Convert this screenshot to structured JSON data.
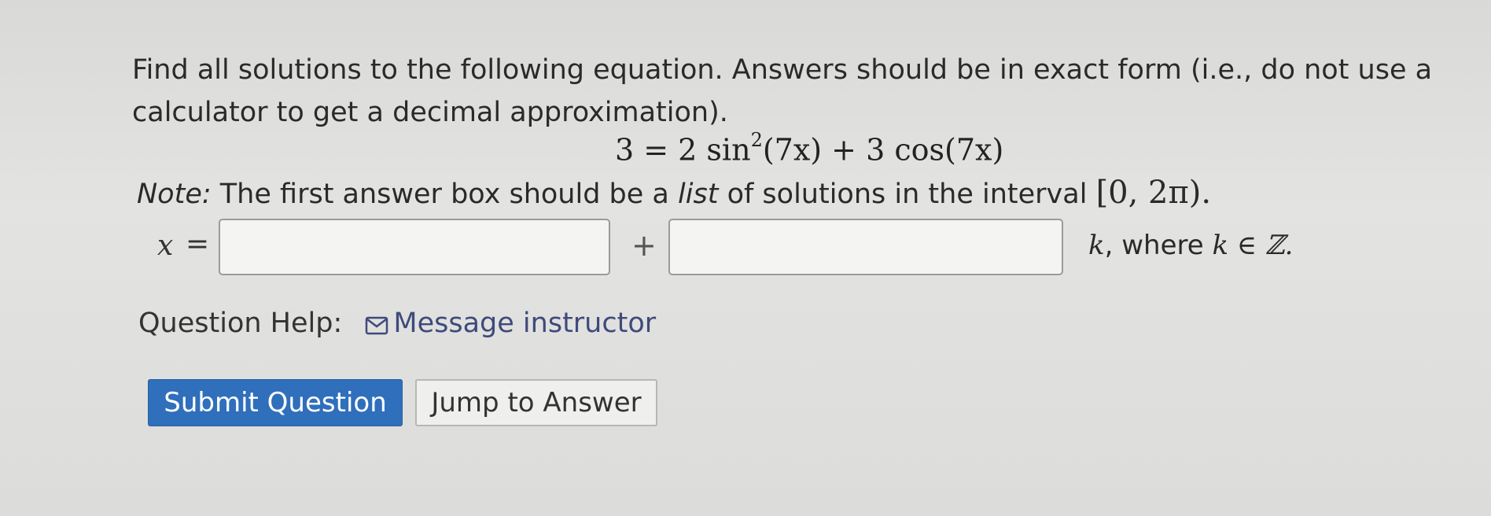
{
  "question": {
    "prompt": "Find all solutions to the following equation. Answers should be in exact form (i.e., do not use a calculator to get a decimal approximation).",
    "equation": {
      "lhs": "3 = 2 sin",
      "exponent": "2",
      "rhs": "(7x) + 3 cos(7x)"
    },
    "note_label": "Note:",
    "note_text_1": "The first answer box should be a",
    "note_emph": "list",
    "note_text_2": "of solutions in the interval",
    "note_interval": "[0, 2π)."
  },
  "answer": {
    "variable": "x",
    "equals": "=",
    "plus": "+",
    "box1_value": "",
    "box2_value": "",
    "suffix_k": "k",
    "suffix_text": ", where",
    "suffix_set": "k ∈ ℤ."
  },
  "help": {
    "label": "Question Help:",
    "message_link": "Message instructor",
    "icon": "mail-icon"
  },
  "buttons": {
    "submit": "Submit Question",
    "jump": "Jump to Answer"
  },
  "colors": {
    "submit_bg": "#2f6fbb",
    "link": "#3e4a7c"
  }
}
